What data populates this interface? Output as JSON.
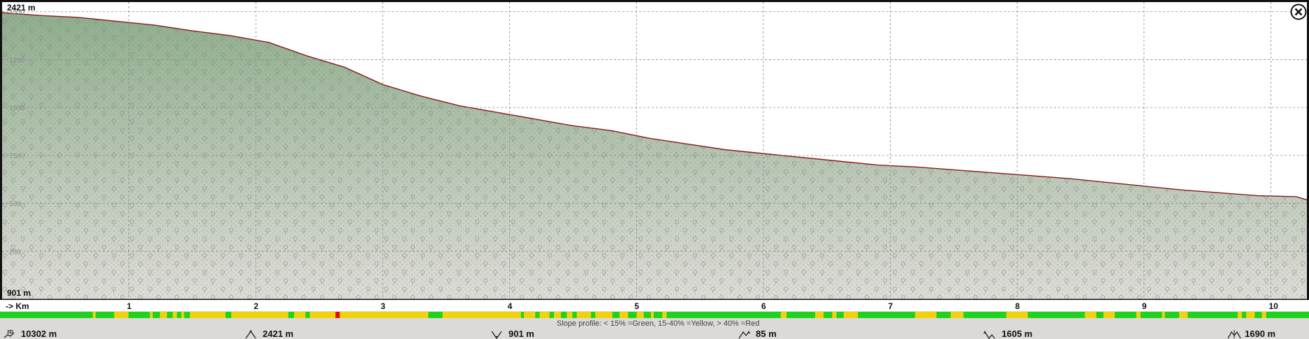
{
  "chart_data": {
    "type": "area",
    "y_top_label": "2421 m",
    "y_bottom_label": "901 m",
    "yticks": [
      250,
      500,
      750,
      1000,
      1250,
      1500
    ],
    "ytick_labels": [
      "250",
      "500",
      "750",
      "1000",
      "1250",
      "1500"
    ],
    "ylim": [
      0,
      1550
    ],
    "xlim": [
      0,
      10.3
    ],
    "x_axis_label": "-> Km",
    "xticks": [
      1,
      2,
      3,
      4,
      5,
      6,
      7,
      8,
      9,
      10
    ],
    "xtick_labels": [
      "1",
      "2",
      "3",
      "4",
      "5",
      "6",
      "7",
      "8",
      "9",
      "10"
    ],
    "grid": true,
    "x": [
      0,
      0.3,
      0.6,
      0.9,
      1.2,
      1.5,
      1.8,
      2.1,
      2.4,
      2.7,
      3.0,
      3.3,
      3.6,
      3.9,
      4.2,
      4.5,
      4.8,
      5.1,
      5.4,
      5.7,
      6.0,
      6.3,
      6.6,
      6.9,
      7.2,
      7.5,
      7.8,
      8.1,
      8.4,
      8.7,
      9.0,
      9.3,
      9.6,
      9.9,
      10.2,
      10.3
    ],
    "y": [
      1495,
      1480,
      1470,
      1450,
      1430,
      1400,
      1375,
      1340,
      1270,
      1210,
      1120,
      1060,
      1010,
      975,
      940,
      905,
      880,
      840,
      810,
      780,
      760,
      740,
      720,
      700,
      690,
      675,
      660,
      645,
      630,
      610,
      590,
      570,
      555,
      540,
      535,
      515
    ],
    "slope_segments": [
      [
        "g",
        0.65
      ],
      [
        "y",
        0.02
      ],
      [
        "g",
        0.13
      ],
      [
        "y",
        0.1
      ],
      [
        "g",
        0.15
      ],
      [
        "y",
        0.02
      ],
      [
        "g",
        0.05
      ],
      [
        "y",
        0.05
      ],
      [
        "g",
        0.04
      ],
      [
        "y",
        0.03
      ],
      [
        "g",
        0.03
      ],
      [
        "y",
        0.02
      ],
      [
        "g",
        0.04
      ],
      [
        "y",
        0.25
      ],
      [
        "g",
        0.04
      ],
      [
        "y",
        0.4
      ],
      [
        "g",
        0.04
      ],
      [
        "y",
        0.08
      ],
      [
        "g",
        0.03
      ],
      [
        "y",
        0.18
      ],
      [
        "r",
        0.03
      ],
      [
        "y",
        0.62
      ],
      [
        "g",
        0.1
      ],
      [
        "y",
        0.55
      ],
      [
        "g",
        0.02
      ],
      [
        "y",
        0.08
      ],
      [
        "g",
        0.03
      ],
      [
        "y",
        0.07
      ],
      [
        "g",
        0.03
      ],
      [
        "y",
        0.05
      ],
      [
        "g",
        0.04
      ],
      [
        "y",
        0.04
      ],
      [
        "g",
        0.03
      ],
      [
        "y",
        0.1
      ],
      [
        "g",
        0.03
      ],
      [
        "y",
        0.12
      ],
      [
        "g",
        0.05
      ],
      [
        "y",
        0.06
      ],
      [
        "g",
        0.06
      ],
      [
        "y",
        0.05
      ],
      [
        "g",
        0.05
      ],
      [
        "y",
        0.02
      ],
      [
        "g",
        0.06
      ],
      [
        "y",
        0.03
      ],
      [
        "g",
        0.8
      ],
      [
        "y",
        0.04
      ],
      [
        "g",
        0.2
      ],
      [
        "y",
        0.06
      ],
      [
        "g",
        0.06
      ],
      [
        "y",
        0.03
      ],
      [
        "g",
        0.05
      ],
      [
        "y",
        0.1
      ],
      [
        "g",
        0.4
      ],
      [
        "y",
        0.15
      ],
      [
        "g",
        0.1
      ],
      [
        "y",
        0.09
      ],
      [
        "g",
        0.3
      ],
      [
        "y",
        0.15
      ],
      [
        "g",
        0.4
      ],
      [
        "y",
        0.08
      ],
      [
        "g",
        0.05
      ],
      [
        "y",
        0.08
      ],
      [
        "g",
        0.15
      ],
      [
        "y",
        0.03
      ],
      [
        "g",
        0.15
      ],
      [
        "y",
        0.02
      ],
      [
        "g",
        0.1
      ],
      [
        "y",
        0.06
      ],
      [
        "g",
        0.35
      ],
      [
        "y",
        0.03
      ],
      [
        "g",
        0.03
      ],
      [
        "y",
        0.06
      ],
      [
        "g",
        0.05
      ],
      [
        "y",
        0.03
      ],
      [
        "g",
        0.3
      ]
    ],
    "slope_legend": "Slope profile: < 15% =Green, 15-40% =Yellow, > 40% =Red",
    "colors": {
      "area": "#9cb49a",
      "line": "#8b1a1a",
      "green": "#1ed21e",
      "yellow": "#f2d20a",
      "red": "#e01010"
    }
  },
  "stats": [
    {
      "icon": "distance-icon",
      "value": "10302 m"
    },
    {
      "icon": "max-elevation-icon",
      "value": "2421 m"
    },
    {
      "icon": "min-elevation-icon",
      "value": "901 m"
    },
    {
      "icon": "ascent-icon",
      "value": "85 m"
    },
    {
      "icon": "descent-icon",
      "value": "1605 m"
    },
    {
      "icon": "elevation-diff-icon",
      "value": "1690 m"
    }
  ],
  "close_icon": "close-icon"
}
